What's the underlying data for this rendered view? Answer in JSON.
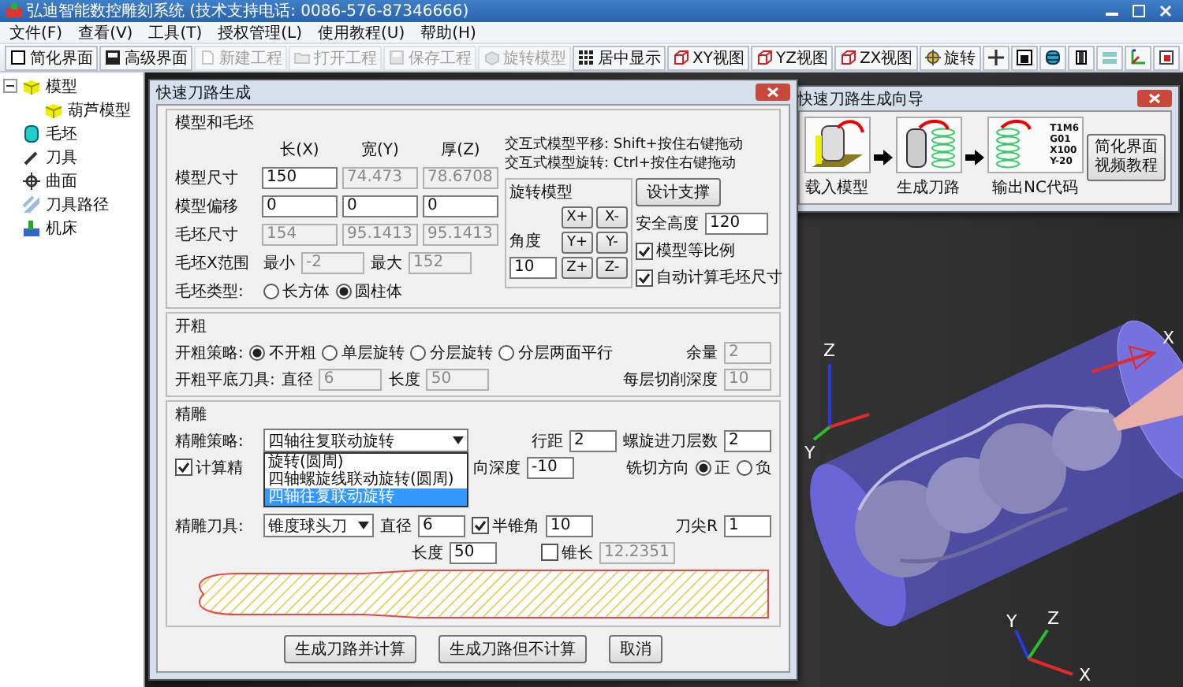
{
  "window": {
    "title": "弘迪智能数控雕刻系统 (技术支持电话: 0086-576-87346666)"
  },
  "menu": [
    "文件(F)",
    "查看(V)",
    "工具(T)",
    "授权管理(L)",
    "使用教程(U)",
    "帮助(H)"
  ],
  "toolbar": [
    {
      "label": "简化界面",
      "kind": "simple",
      "disabled": false
    },
    {
      "label": "高级界面",
      "kind": "advanced",
      "disabled": false
    },
    {
      "label": "新建工程",
      "kind": "new",
      "disabled": true
    },
    {
      "label": "打开工程",
      "kind": "open",
      "disabled": true
    },
    {
      "label": "保存工程",
      "kind": "save",
      "disabled": true
    },
    {
      "label": "旋转模型",
      "kind": "rotate",
      "disabled": true
    },
    {
      "label": "居中显示",
      "kind": "center",
      "disabled": false
    },
    {
      "label": "XY视图",
      "kind": "view",
      "disabled": false
    },
    {
      "label": "YZ视图",
      "kind": "view",
      "disabled": false
    },
    {
      "label": "ZX视图",
      "kind": "view",
      "disabled": false
    },
    {
      "label": "旋转",
      "kind": "spin",
      "disabled": false
    },
    {
      "kind": "move",
      "disabled": false
    },
    {
      "kind": "solid",
      "disabled": false
    },
    {
      "kind": "cylinder",
      "disabled": false
    },
    {
      "kind": "section",
      "disabled": false
    },
    {
      "kind": "layers",
      "disabled": false
    },
    {
      "kind": "axes",
      "disabled": false
    },
    {
      "kind": "frame",
      "disabled": false
    }
  ],
  "tree": [
    {
      "label": "模型",
      "kind": "model",
      "expanded": true,
      "children": [
        {
          "label": "葫芦模型",
          "kind": "model"
        }
      ]
    },
    {
      "label": "毛坯",
      "kind": "stock"
    },
    {
      "label": "刀具",
      "kind": "tool"
    },
    {
      "label": "曲面",
      "kind": "surface"
    },
    {
      "label": "刀具路径",
      "kind": "toolpath"
    },
    {
      "label": "机床",
      "kind": "machine"
    }
  ],
  "viewport": {
    "model_axes": [
      "Z",
      "Y",
      "X"
    ],
    "world_axes": [
      "Y",
      "Z",
      "X"
    ]
  },
  "wizard": {
    "title": "快速刀路生成向导",
    "steps": [
      {
        "label": "载入模型",
        "kind": "load"
      },
      {
        "label": "生成刀路",
        "kind": "path"
      },
      {
        "label": "输出NC代码",
        "kind": "nc",
        "code": [
          "T1M6",
          "G01",
          "X100",
          "Y-20"
        ]
      }
    ],
    "video_button": [
      "简化界面",
      "视频教程"
    ]
  },
  "dialog": {
    "title": "快速刀路生成",
    "model_stock": {
      "title": "模型和毛坯",
      "columns": [
        "长(X)",
        "宽(Y)",
        "厚(Z)"
      ],
      "rows": [
        {
          "label": "模型尺寸",
          "values": [
            {
              "value": "150",
              "disabled": false
            },
            {
              "value": "74.473",
              "disabled": true
            },
            {
              "value": "78.6708",
              "disabled": true
            }
          ]
        },
        {
          "label": "模型偏移",
          "values": [
            {
              "value": "0",
              "disabled": false
            },
            {
              "value": "0",
              "disabled": false
            },
            {
              "value": "0",
              "disabled": false
            }
          ]
        },
        {
          "label": "毛坯尺寸",
          "values": [
            {
              "value": "154",
              "disabled": true
            },
            {
              "value": "95.1413",
              "disabled": true
            },
            {
              "value": "95.1413",
              "disabled": true
            }
          ]
        }
      ],
      "x_range": {
        "label": "毛坯X范围",
        "min_label": "最小",
        "min": {
          "value": "-2",
          "disabled": true
        },
        "max_label": "最大",
        "max": {
          "value": "152",
          "disabled": true
        }
      },
      "stock_type": {
        "label": "毛坯类型:",
        "options": [
          {
            "label": "长方体",
            "selected": false
          },
          {
            "label": "圆柱体",
            "selected": true
          }
        ]
      },
      "hints": [
        "交互式模型平移: Shift+按住右键拖动",
        "交互式模型旋转: Ctrl+按住右键拖动"
      ],
      "rotate": {
        "title": "旋转模型",
        "angle_label": "角度",
        "angle": {
          "value": "10",
          "disabled": false
        },
        "buttons": [
          "X+",
          "X-",
          "Y+",
          "Y-",
          "Z+",
          "Z-"
        ]
      },
      "support_button": "设计支撑",
      "safe_height": {
        "label": "安全高度",
        "value": {
          "value": "120",
          "disabled": false
        }
      },
      "checks": [
        {
          "label": "模型等比例",
          "checked": true
        },
        {
          "label": "自动计算毛坯尺寸",
          "checked": true
        }
      ]
    },
    "roughing": {
      "title": "开粗",
      "strategy_label": "开粗策略:",
      "options": [
        {
          "label": "不开粗",
          "selected": true
        },
        {
          "label": "单层旋转",
          "selected": false
        },
        {
          "label": "分层旋转",
          "selected": false
        },
        {
          "label": "分层两面平行",
          "selected": false
        }
      ],
      "allowance_label": "余量",
      "allowance": {
        "value": "2",
        "disabled": true
      },
      "tool_label": "开粗平底刀具:",
      "diameter_label": "直径",
      "diameter": {
        "value": "6",
        "disabled": true
      },
      "length_label": "长度",
      "length": {
        "value": "50",
        "disabled": true
      },
      "depth_label": "每层切削深度",
      "depth": {
        "value": "10",
        "disabled": true
      }
    },
    "finishing": {
      "title": "精雕",
      "strategy_label": "精雕策略:",
      "strategy": "四轴往复联动旋转",
      "dropdown_options": [
        {
          "label": "旋转(圆周)",
          "selected": false
        },
        {
          "label": "四轴螺旋线联动旋转(圆周)",
          "selected": false
        },
        {
          "label": "四轴往复联动旋转",
          "selected": true
        }
      ],
      "step_label": "行距",
      "step": {
        "value": "2",
        "disabled": false
      },
      "spiral_label": "螺旋进刀层数",
      "spiral": {
        "value": "2",
        "disabled": false
      },
      "calc": {
        "label": "计算精",
        "checked": true
      },
      "depth_label": "向深度",
      "depth": {
        "value": "-10",
        "disabled": false
      },
      "direction_label": "铣切方向",
      "directions": [
        {
          "label": "正",
          "selected": true
        },
        {
          "label": "负",
          "selected": false
        }
      ],
      "tool_label": "精雕刀具:",
      "tool": "锥度球头刀",
      "diameter_label": "直径",
      "diameter": {
        "value": "6",
        "disabled": false
      },
      "half_angle": {
        "label": "半锥角",
        "checked": true,
        "value": {
          "value": "10",
          "disabled": false
        }
      },
      "tip_label": "刀尖R",
      "tip": {
        "value": "1",
        "disabled": false
      },
      "length_label": "长度",
      "length": {
        "value": "50",
        "disabled": false
      },
      "taper": {
        "label": "锥长",
        "checked": false,
        "value": {
          "value": "12.2351",
          "disabled": true
        }
      }
    },
    "buttons": [
      "生成刀路并计算",
      "生成刀路但不计算",
      "取消"
    ]
  }
}
